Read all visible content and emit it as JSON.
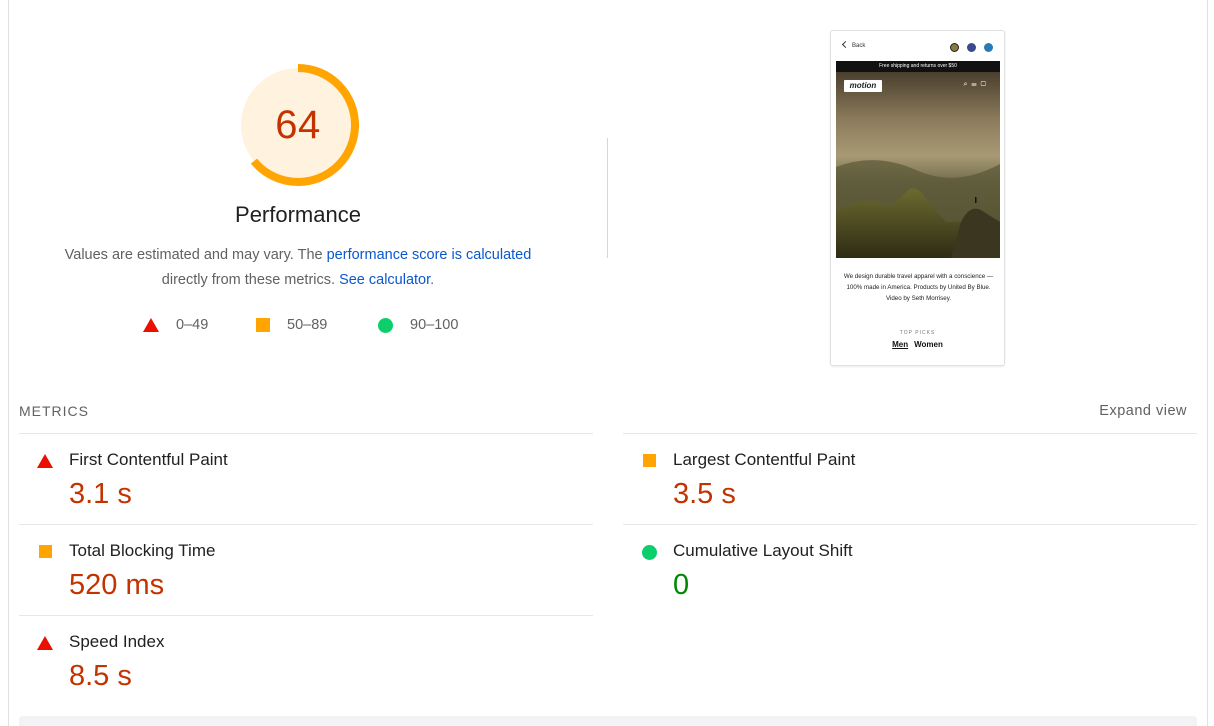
{
  "score": {
    "value": "64",
    "fraction": 0.64,
    "title": "Performance",
    "color": "#ffa400",
    "bg_color": "#fff3e0",
    "text_color": "#c33300"
  },
  "description": {
    "prefix": "Values are estimated and may vary. The ",
    "link1": "performance score is calculated",
    "middle": " directly from these metrics. ",
    "link2": "See calculator",
    "suffix": "."
  },
  "legend": {
    "fail": "0–49",
    "average": "50–89",
    "pass": "90–100"
  },
  "screenshot": {
    "back": "Back",
    "swatches": [
      "#8a7a3a",
      "#3b4a8c",
      "#2a7ab5"
    ],
    "banner": "Free shipping and returns over $50",
    "logo": "motion",
    "copy": "We design durable travel apparel with a conscience — 100% made in America. Products by United By Blue. Video by Seth Morrisey.",
    "top_picks": "TOP PICKS",
    "tab_men": "Men",
    "tab_women": "Women"
  },
  "metrics": {
    "heading": "METRICS",
    "expand": "Expand view",
    "items": [
      {
        "name": "First Contentful Paint",
        "value": "3.1 s",
        "rating": "fail"
      },
      {
        "name": "Largest Contentful Paint",
        "value": "3.5 s",
        "rating": "average"
      },
      {
        "name": "Total Blocking Time",
        "value": "520 ms",
        "rating": "average"
      },
      {
        "name": "Cumulative Layout Shift",
        "value": "0",
        "rating": "pass"
      },
      {
        "name": "Speed Index",
        "value": "8.5 s",
        "rating": "fail"
      }
    ]
  }
}
